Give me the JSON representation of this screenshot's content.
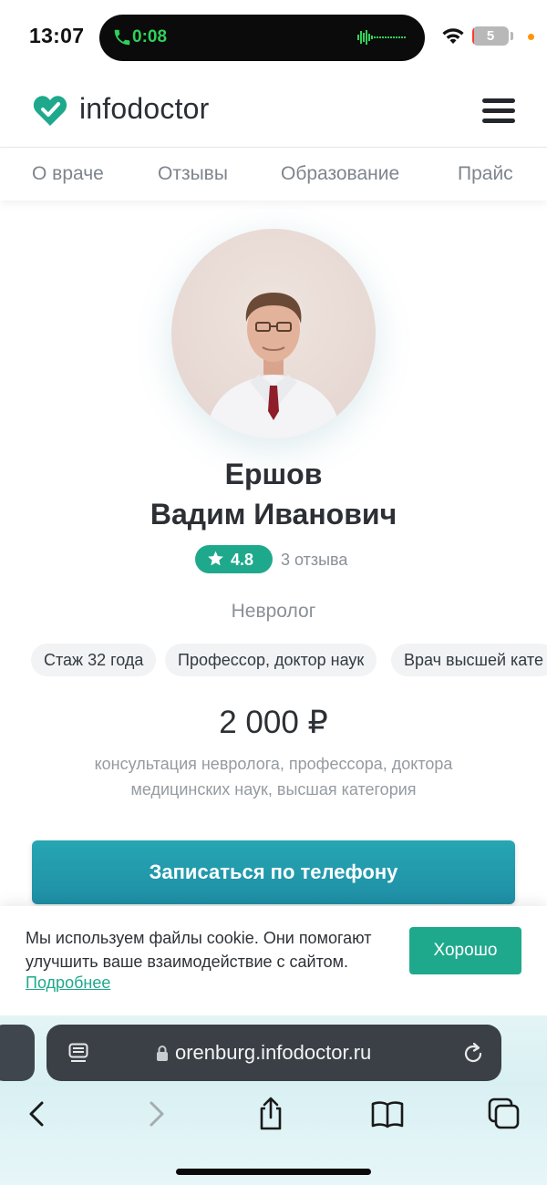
{
  "status_bar": {
    "time": "13:07",
    "call_timer": "0:08",
    "battery_level": "5",
    "battery_fraction": 0.05,
    "icons": [
      "phone-icon",
      "voice-wave-icon",
      "wifi-icon",
      "battery-icon"
    ]
  },
  "header": {
    "logo_text": "infodoctor",
    "icons": [
      "heart-check-logo-icon",
      "hamburger-menu-icon"
    ]
  },
  "tabs": [
    {
      "label": "О враче"
    },
    {
      "label": "Отзывы"
    },
    {
      "label": "Образование"
    },
    {
      "label": "Прайс"
    }
  ],
  "doctor": {
    "last_name": "Ершов",
    "first_middle_name": "Вадим Иванович",
    "rating": "4.8",
    "reviews": "3 отзыва",
    "specialty": "Невролог",
    "chips": [
      {
        "label": "Стаж 32 года"
      },
      {
        "label": "Профессор, доктор наук"
      },
      {
        "label": "Врач высшей кате"
      }
    ],
    "price": "2 000 ₽",
    "price_description": "консультация невролога, профессора, доктора медицинских наук, высшая категория",
    "call_button": "Записаться по телефону"
  },
  "cookie_banner": {
    "text": "Мы используем файлы cookie. Они помогают улучшить ваше взаимодействие с сайтом.",
    "link": "Подробнее",
    "accept": "Хорошо"
  },
  "browser": {
    "url": "orenburg.infodoctor.ru",
    "icons": [
      "reader-icon",
      "lock-icon",
      "reload-icon",
      "back-icon",
      "forward-icon",
      "share-icon",
      "bookmarks-icon",
      "tabs-icon"
    ]
  },
  "colors": {
    "brand_green": "#1fa98c",
    "button_teal": "#2199ab",
    "call_green": "#2fd15a"
  }
}
